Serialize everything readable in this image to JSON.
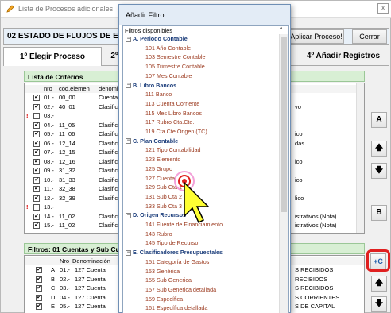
{
  "window": {
    "title": "Lista de Procesos adicionales",
    "close_label": "X"
  },
  "header": {
    "title": "02 ESTADO DE FLUJOS DE EF",
    "apply_label": "Aplicar Proceso!",
    "close_label": "Cerrar"
  },
  "tabs": [
    {
      "label": "1º Elegir Proceso"
    },
    {
      "label": "2º"
    },
    {
      "label": "4º Añadir Registros"
    }
  ],
  "criterios": {
    "title": "Lista de Criterios",
    "columns": [
      "nro",
      "cód.elemen",
      "denomina"
    ],
    "rows": [
      {
        "mark": "",
        "checked": "✔",
        "nro": "01.-",
        "cod": "00_00",
        "den": "Cuentas",
        "extra": ""
      },
      {
        "mark": "",
        "checked": "✔",
        "nro": "02.-",
        "cod": "40_01",
        "den": "Clasifica",
        "extra": "vo"
      },
      {
        "mark": "!",
        "checked": "",
        "nro": "03.-",
        "cod": "",
        "den": "",
        "extra": ""
      },
      {
        "mark": "",
        "checked": "✔",
        "nro": "04.-",
        "cod": "11_05",
        "den": "Clasifica",
        "extra": ""
      },
      {
        "mark": "",
        "checked": "✔",
        "nro": "05.-",
        "cod": "11_06",
        "den": "Clasifica",
        "extra": "ico"
      },
      {
        "mark": "",
        "checked": "✔",
        "nro": "06.-",
        "cod": "12_14",
        "den": "Clasifica",
        "extra": "das"
      },
      {
        "mark": "",
        "checked": "✔",
        "nro": "07.-",
        "cod": "12_15",
        "den": "Clasifica",
        "extra": ""
      },
      {
        "mark": "",
        "checked": "✔",
        "nro": "08.-",
        "cod": "12_16",
        "den": "Clasifica",
        "extra": "ico"
      },
      {
        "mark": "",
        "checked": "✔",
        "nro": "09.-",
        "cod": "31_32",
        "den": "Clasifica",
        "extra": ""
      },
      {
        "mark": "",
        "checked": "✔",
        "nro": "10.-",
        "cod": "31_33",
        "den": "Clasifica",
        "extra": "ico"
      },
      {
        "mark": "",
        "checked": "✔",
        "nro": "11.-",
        "cod": "32_38",
        "den": "Clasifica",
        "extra": ""
      },
      {
        "mark": "",
        "checked": "✔",
        "nro": "12.-",
        "cod": "32_39",
        "den": "Clasifica",
        "extra": "lico"
      },
      {
        "mark": "!",
        "checked": "",
        "nro": "13.-",
        "cod": "",
        "den": "",
        "extra": ""
      },
      {
        "mark": "",
        "checked": "✔",
        "nro": "14.-",
        "cod": "11_02",
        "den": "Clasifica",
        "extra": "istrativos (Nota)"
      },
      {
        "mark": "",
        "checked": "✔",
        "nro": "15.-",
        "cod": "11_02",
        "den": "Clasifica",
        "extra": "istrativos (Nota)"
      }
    ]
  },
  "filtros": {
    "title": "Filtros: 01 Cuentas y Sub Cuen",
    "columns": [
      "Nro",
      "Denominación"
    ],
    "rows": [
      {
        "checked": "✔",
        "letter": "A",
        "nro": "01.-",
        "den": "127 Cuenta",
        "extra": "S RECIBIDOS"
      },
      {
        "checked": "✔",
        "letter": "B",
        "nro": "02.-",
        "den": "127 Cuenta",
        "extra": "RECIBIDOS"
      },
      {
        "checked": "✔",
        "letter": "C",
        "nro": "03.-",
        "den": "127 Cuenta",
        "extra": "S RECIBIDOS"
      },
      {
        "checked": "✔",
        "letter": "D",
        "nro": "04.-",
        "den": "127 Cuenta",
        "extra": "S CORRIENTES"
      },
      {
        "checked": "✔",
        "letter": "E",
        "nro": "05.-",
        "den": "127 Cuenta",
        "extra": "S DE CAPITAL"
      }
    ]
  },
  "side_buttons": {
    "a": "A",
    "up": "🡅",
    "down": "🡇",
    "b": "B",
    "add": "+C",
    "up2": "🡅",
    "down2": "🡇"
  },
  "popup": {
    "title": "Añadir Filtro",
    "tree_header": "Filtros disponibles",
    "nodes": [
      {
        "type": "g",
        "label": "A. Periodo Contable"
      },
      {
        "type": "i",
        "label": "101 Año Contable"
      },
      {
        "type": "i",
        "label": "103 Semestre Contable"
      },
      {
        "type": "i",
        "label": "105 Trimestre Contable"
      },
      {
        "type": "i",
        "label": "107 Mes Contable"
      },
      {
        "type": "g",
        "label": "B. Libro Bancos"
      },
      {
        "type": "i",
        "label": "111 Banco"
      },
      {
        "type": "i",
        "label": "113 Cuenta Corriente"
      },
      {
        "type": "i",
        "label": "115 Mes Libro Bancos"
      },
      {
        "type": "i",
        "label": "117 Rubro Cta.Cte."
      },
      {
        "type": "i",
        "label": "119 Cta.Cte.Origen (TC)"
      },
      {
        "type": "g",
        "label": "C. Plan Contable"
      },
      {
        "type": "i",
        "label": "121 Tipo Contabilidad"
      },
      {
        "type": "i",
        "label": "123 Elemento"
      },
      {
        "type": "i",
        "label": "125 Grupo"
      },
      {
        "type": "i",
        "label": "127 Cuenta"
      },
      {
        "type": "i",
        "label": "129 Sub Cta 1"
      },
      {
        "type": "i",
        "label": "131 Sub Cta 2"
      },
      {
        "type": "i",
        "label": "133 Sub Cta 3"
      },
      {
        "type": "g",
        "label": "D. Origen Recursos"
      },
      {
        "type": "i",
        "label": "141 Fuente de Financiamiento"
      },
      {
        "type": "i",
        "label": "143 Rubro"
      },
      {
        "type": "i",
        "label": "145 Tipo de Recurso"
      },
      {
        "type": "g",
        "label": "E. Clasificadores Presupuestales"
      },
      {
        "type": "i",
        "label": "151 Categoría de Gastos"
      },
      {
        "type": "i",
        "label": "153 Genérica"
      },
      {
        "type": "i",
        "label": "155 Sub Generica"
      },
      {
        "type": "i",
        "label": "157 Sub Generica detallada"
      },
      {
        "type": "i",
        "label": "159 Específica"
      },
      {
        "type": "i",
        "label": "161 Específica detallada"
      }
    ]
  },
  "colors": {
    "group": "#1a3c7a",
    "item": "#9c3b20",
    "highlight_red": "#e02020",
    "cursor": "#ffff33"
  }
}
